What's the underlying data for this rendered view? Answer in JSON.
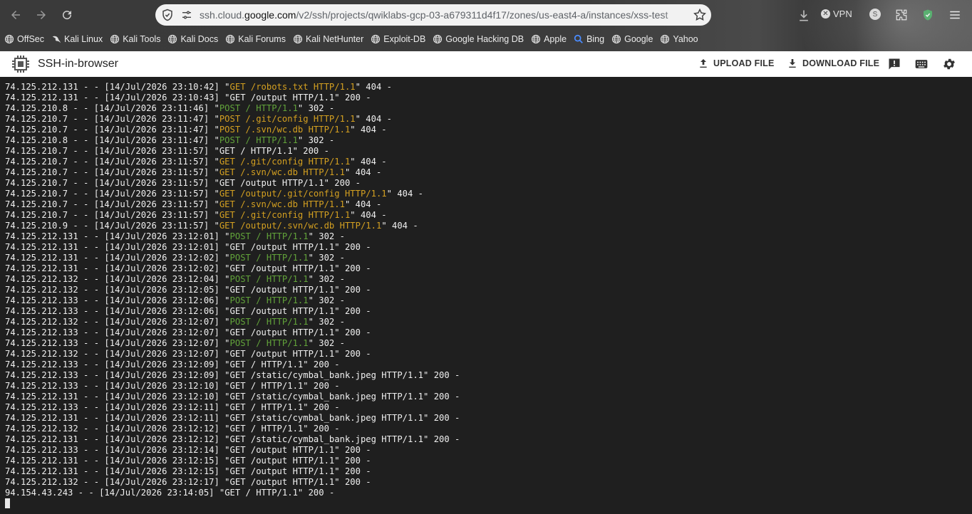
{
  "browser": {
    "url_prefix": "ssh.cloud.",
    "url_domain": "google.com",
    "url_path": "/v2/ssh/projects/qwiklabs-gcp-03-a679311d4f17/zones/us-east4-a/instances/xss-test",
    "vpn_label": "VPN",
    "profile_initial": "S",
    "bookmarks": [
      {
        "label": "OffSec",
        "icon": "globe-icon"
      },
      {
        "label": "Kali Linux",
        "icon": "kali-dragon-icon"
      },
      {
        "label": "Kali Tools",
        "icon": "globe-icon"
      },
      {
        "label": "Kali Docs",
        "icon": "globe-icon"
      },
      {
        "label": "Kali Forums",
        "icon": "globe-icon"
      },
      {
        "label": "Kali NetHunter",
        "icon": "globe-icon"
      },
      {
        "label": "Exploit-DB",
        "icon": "globe-icon"
      },
      {
        "label": "Google Hacking DB",
        "icon": "globe-icon"
      },
      {
        "label": "Apple",
        "icon": "globe-icon"
      },
      {
        "label": "Bing",
        "icon": "search-icon"
      },
      {
        "label": "Google",
        "icon": "globe-icon"
      },
      {
        "label": "Yahoo",
        "icon": "globe-icon"
      }
    ]
  },
  "header": {
    "title": "SSH-in-browser",
    "upload_label": "UPLOAD FILE",
    "download_label": "DOWNLOAD FILE"
  },
  "colors": {
    "get_request": "#d4a020",
    "post_request": "#62a33a",
    "terminal_bg": "#1f1f1f"
  },
  "terminal": {
    "lines": [
      {
        "pre": "74.125.212.131 - - [14/Jul/2026 23:10:42] \"",
        "req": "GET /robots.txt HTTP/1.1",
        "color": "orange",
        "post": "\" 404 -"
      },
      {
        "pre": "74.125.212.131 - - [14/Jul/2026 23:10:43] \"",
        "req": "GET /output HTTP/1.1",
        "color": "none",
        "post": "\" 200 -"
      },
      {
        "pre": "74.125.210.8 - - [14/Jul/2026 23:11:46] \"",
        "req": "POST / HTTP/1.1",
        "color": "green",
        "post": "\" 302 -"
      },
      {
        "pre": "74.125.210.7 - - [14/Jul/2026 23:11:47] \"",
        "req": "POST /.git/config HTTP/1.1",
        "color": "orange",
        "post": "\" 404 -"
      },
      {
        "pre": "74.125.210.7 - - [14/Jul/2026 23:11:47] \"",
        "req": "POST /.svn/wc.db HTTP/1.1",
        "color": "orange",
        "post": "\" 404 -"
      },
      {
        "pre": "74.125.210.8 - - [14/Jul/2026 23:11:47] \"",
        "req": "POST / HTTP/1.1",
        "color": "green",
        "post": "\" 302 -"
      },
      {
        "pre": "74.125.210.7 - - [14/Jul/2026 23:11:57] \"",
        "req": "GET / HTTP/1.1",
        "color": "none",
        "post": "\" 200 -"
      },
      {
        "pre": "74.125.210.7 - - [14/Jul/2026 23:11:57] \"",
        "req": "GET /.git/config HTTP/1.1",
        "color": "orange",
        "post": "\" 404 -"
      },
      {
        "pre": "74.125.210.7 - - [14/Jul/2026 23:11:57] \"",
        "req": "GET /.svn/wc.db HTTP/1.1",
        "color": "orange",
        "post": "\" 404 -"
      },
      {
        "pre": "74.125.210.7 - - [14/Jul/2026 23:11:57] \"",
        "req": "GET /output HTTP/1.1",
        "color": "none",
        "post": "\" 200 -"
      },
      {
        "pre": "74.125.210.7 - - [14/Jul/2026 23:11:57] \"",
        "req": "GET /output/.git/config HTTP/1.1",
        "color": "orange",
        "post": "\" 404 -"
      },
      {
        "pre": "74.125.210.7 - - [14/Jul/2026 23:11:57] \"",
        "req": "GET /.svn/wc.db HTTP/1.1",
        "color": "orange",
        "post": "\" 404 -"
      },
      {
        "pre": "74.125.210.7 - - [14/Jul/2026 23:11:57] \"",
        "req": "GET /.git/config HTTP/1.1",
        "color": "orange",
        "post": "\" 404 -"
      },
      {
        "pre": "74.125.210.9 - - [14/Jul/2026 23:11:57] \"",
        "req": "GET /output/.svn/wc.db HTTP/1.1",
        "color": "orange",
        "post": "\" 404 -"
      },
      {
        "pre": "74.125.212.131 - - [14/Jul/2026 23:12:01] \"",
        "req": "POST / HTTP/1.1",
        "color": "green",
        "post": "\" 302 -"
      },
      {
        "pre": "74.125.212.131 - - [14/Jul/2026 23:12:01] \"",
        "req": "GET /output HTTP/1.1",
        "color": "none",
        "post": "\" 200 -"
      },
      {
        "pre": "74.125.212.131 - - [14/Jul/2026 23:12:02] \"",
        "req": "POST / HTTP/1.1",
        "color": "green",
        "post": "\" 302 -"
      },
      {
        "pre": "74.125.212.131 - - [14/Jul/2026 23:12:02] \"",
        "req": "GET /output HTTP/1.1",
        "color": "none",
        "post": "\" 200 -"
      },
      {
        "pre": "74.125.212.132 - - [14/Jul/2026 23:12:04] \"",
        "req": "POST / HTTP/1.1",
        "color": "green",
        "post": "\" 302 -"
      },
      {
        "pre": "74.125.212.132 - - [14/Jul/2026 23:12:05] \"",
        "req": "GET /output HTTP/1.1",
        "color": "none",
        "post": "\" 200 -"
      },
      {
        "pre": "74.125.212.133 - - [14/Jul/2026 23:12:06] \"",
        "req": "POST / HTTP/1.1",
        "color": "green",
        "post": "\" 302 -"
      },
      {
        "pre": "74.125.212.133 - - [14/Jul/2026 23:12:06] \"",
        "req": "GET /output HTTP/1.1",
        "color": "none",
        "post": "\" 200 -"
      },
      {
        "pre": "74.125.212.132 - - [14/Jul/2026 23:12:07] \"",
        "req": "POST / HTTP/1.1",
        "color": "green",
        "post": "\" 302 -"
      },
      {
        "pre": "74.125.212.133 - - [14/Jul/2026 23:12:07] \"",
        "req": "GET /output HTTP/1.1",
        "color": "none",
        "post": "\" 200 -"
      },
      {
        "pre": "74.125.212.133 - - [14/Jul/2026 23:12:07] \"",
        "req": "POST / HTTP/1.1",
        "color": "green",
        "post": "\" 302 -"
      },
      {
        "pre": "74.125.212.132 - - [14/Jul/2026 23:12:07] \"",
        "req": "GET /output HTTP/1.1",
        "color": "none",
        "post": "\" 200 -"
      },
      {
        "pre": "74.125.212.133 - - [14/Jul/2026 23:12:09] \"",
        "req": "GET / HTTP/1.1",
        "color": "none",
        "post": "\" 200 -"
      },
      {
        "pre": "74.125.212.133 - - [14/Jul/2026 23:12:09] \"",
        "req": "GET /static/cymbal_bank.jpeg HTTP/1.1",
        "color": "none",
        "post": "\" 200 -"
      },
      {
        "pre": "74.125.212.133 - - [14/Jul/2026 23:12:10] \"",
        "req": "GET / HTTP/1.1",
        "color": "none",
        "post": "\" 200 -"
      },
      {
        "pre": "74.125.212.131 - - [14/Jul/2026 23:12:10] \"",
        "req": "GET /static/cymbal_bank.jpeg HTTP/1.1",
        "color": "none",
        "post": "\" 200 -"
      },
      {
        "pre": "74.125.212.133 - - [14/Jul/2026 23:12:11] \"",
        "req": "GET / HTTP/1.1",
        "color": "none",
        "post": "\" 200 -"
      },
      {
        "pre": "74.125.212.131 - - [14/Jul/2026 23:12:11] \"",
        "req": "GET /static/cymbal_bank.jpeg HTTP/1.1",
        "color": "none",
        "post": "\" 200 -"
      },
      {
        "pre": "74.125.212.132 - - [14/Jul/2026 23:12:12] \"",
        "req": "GET / HTTP/1.1",
        "color": "none",
        "post": "\" 200 -"
      },
      {
        "pre": "74.125.212.131 - - [14/Jul/2026 23:12:12] \"",
        "req": "GET /static/cymbal_bank.jpeg HTTP/1.1",
        "color": "none",
        "post": "\" 200 -"
      },
      {
        "pre": "74.125.212.133 - - [14/Jul/2026 23:12:14] \"",
        "req": "GET /output HTTP/1.1",
        "color": "none",
        "post": "\" 200 -"
      },
      {
        "pre": "74.125.212.131 - - [14/Jul/2026 23:12:15] \"",
        "req": "GET /output HTTP/1.1",
        "color": "none",
        "post": "\" 200 -"
      },
      {
        "pre": "74.125.212.131 - - [14/Jul/2026 23:12:15] \"",
        "req": "GET /output HTTP/1.1",
        "color": "none",
        "post": "\" 200 -"
      },
      {
        "pre": "74.125.212.132 - - [14/Jul/2026 23:12:17] \"",
        "req": "GET /output HTTP/1.1",
        "color": "none",
        "post": "\" 200 -"
      },
      {
        "pre": "94.154.43.243 - - [14/Jul/2026 23:14:05] \"",
        "req": "GET / HTTP/1.1",
        "color": "none",
        "post": "\" 200 -"
      }
    ]
  }
}
